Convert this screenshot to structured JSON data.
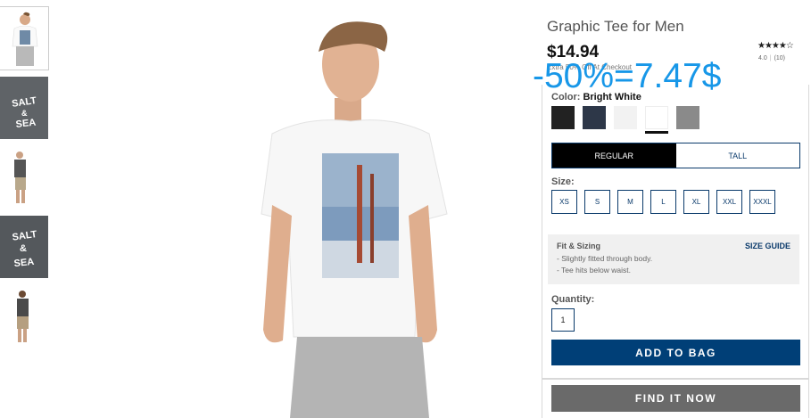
{
  "product": {
    "title": "Graphic Tee for Men",
    "price": "$14.94",
    "stars": "★★★★☆",
    "rating_value": "4.0",
    "review_count": "(10)",
    "promo": "Extra 50% Off At Checkout",
    "overlay_note": "-50%=7.47$"
  },
  "color": {
    "label": "Color:",
    "selected_name": "Bright White",
    "swatches": [
      {
        "hex": "#222222"
      },
      {
        "hex": "#2d3748"
      },
      {
        "hex": "#f2f2f2"
      },
      {
        "hex": "#ffffff"
      },
      {
        "hex": "#8a8a8a"
      }
    ]
  },
  "fit": {
    "tabs": [
      "REGULAR",
      "TALL"
    ]
  },
  "size": {
    "label": "Size:",
    "options": [
      "XS",
      "S",
      "M",
      "L",
      "XL",
      "XXL",
      "XXXL"
    ]
  },
  "fit_info": {
    "title": "Fit & Sizing",
    "guide_link": "SIZE GUIDE",
    "lines": [
      "- Slightly fitted through body.",
      "- Tee hits below waist."
    ]
  },
  "quantity": {
    "label": "Quantity:",
    "value": "1"
  },
  "actions": {
    "add_to_bag": "ADD TO BAG",
    "find_it_now": "FIND IT NOW"
  },
  "thumbnails": {
    "salt_text_1": "SALT",
    "salt_text_2": "&",
    "salt_text_3": "SEA"
  },
  "colors": {
    "brand_blue": "#003f77",
    "accent_overlay": "#1797e8",
    "gray_button": "#6a6a6a"
  }
}
